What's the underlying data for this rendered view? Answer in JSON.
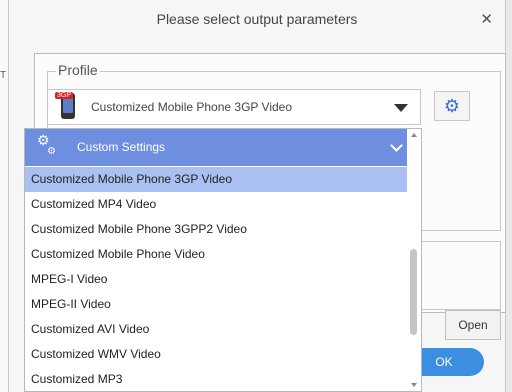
{
  "background": {
    "fragment": "T"
  },
  "dialog": {
    "title": "Please select output parameters",
    "close_glyph": "✕",
    "profile": {
      "label": "Profile",
      "selected_value": "Customized Mobile Phone 3GP Video",
      "icon_tag": "3GP",
      "icon": "phone-3gp-icon",
      "settings_icon": "gear-icon"
    },
    "open_label": "Open",
    "ok_label": "OK"
  },
  "dropdown": {
    "header": "Custom Settings",
    "header_icon": "gears-icon",
    "accent": "#6e8fe0",
    "selected_highlight": "#a9c0f0",
    "items": [
      "Customized Mobile Phone 3GP Video",
      "Customized MP4 Video",
      "Customized Mobile Phone 3GPP2 Video",
      "Customized Mobile Phone Video",
      "MPEG-I Video",
      "MPEG-II Video",
      "Customized AVI Video",
      "Customized WMV Video",
      "Customized MP3"
    ]
  }
}
